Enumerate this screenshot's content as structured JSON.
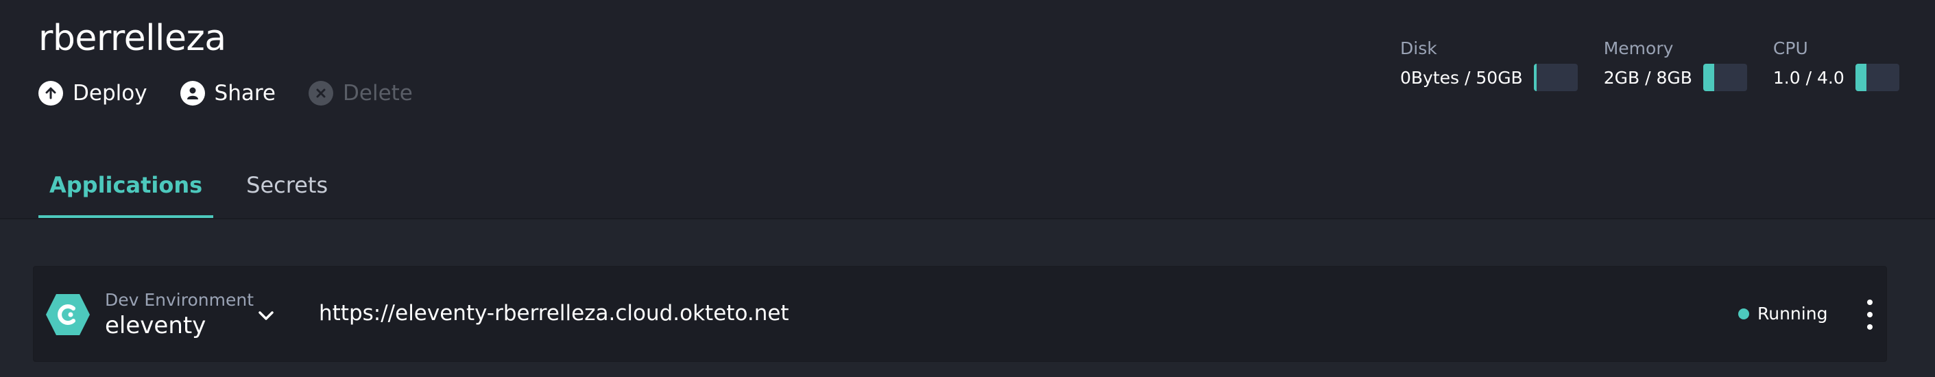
{
  "header": {
    "title": "rberrelleza",
    "actions": [
      {
        "label": "Deploy",
        "icon": "arrow-up-circle-icon",
        "enabled": true
      },
      {
        "label": "Share",
        "icon": "user-circle-icon",
        "enabled": true
      },
      {
        "label": "Delete",
        "icon": "x-circle-icon",
        "enabled": false
      }
    ],
    "stats": [
      {
        "name": "Disk",
        "value": "0Bytes / 50GB",
        "fraction": 0.0
      },
      {
        "name": "Memory",
        "value": "2GB / 8GB",
        "fraction": 0.25
      },
      {
        "name": "CPU",
        "value": "1.0 / 4.0",
        "fraction": 0.25
      }
    ]
  },
  "tabs": [
    {
      "label": "Applications",
      "active": true
    },
    {
      "label": "Secrets",
      "active": false
    }
  ],
  "apps": [
    {
      "kind": "Dev Environment",
      "name": "eleventy",
      "url": "https://eleventy-rberrelleza.cloud.okteto.net",
      "status": "Running",
      "icon": "okteto-hex-icon"
    }
  ],
  "colors": {
    "accent": "#4dc9bd",
    "header_bg": "#1f2129",
    "body_bg": "#22252d",
    "card_bg": "#1b1d24"
  }
}
